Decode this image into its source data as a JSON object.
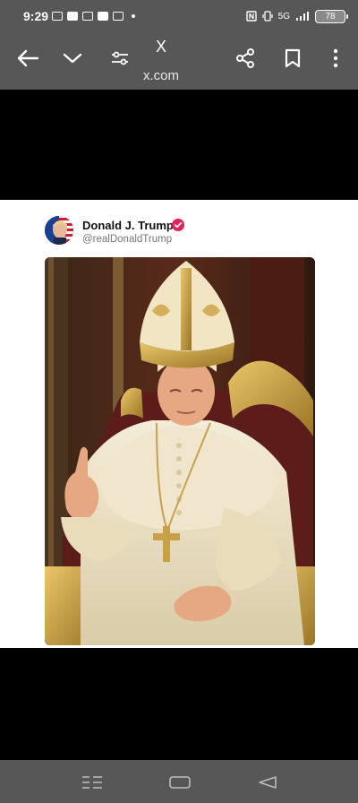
{
  "status_bar": {
    "time": "9:29",
    "signal_text": "5G",
    "battery": "78"
  },
  "toolbar": {
    "title": "X",
    "url": "x.com"
  },
  "post": {
    "display_name": "Donald J. Trump",
    "handle": "@realDonaldTrump",
    "verified_color": "#e0245e"
  },
  "icons": {
    "back": "back-arrow-icon",
    "dropdown": "chevron-down-icon",
    "settings": "page-settings-icon",
    "share": "share-icon",
    "bookmark": "bookmark-icon",
    "more": "more-vertical-icon",
    "nav_menu": "recent-apps-icon",
    "nav_home": "home-icon",
    "nav_back": "back-triangle-icon"
  },
  "colors": {
    "chrome_bg": "#575757",
    "card_bg": "#ffffff"
  }
}
